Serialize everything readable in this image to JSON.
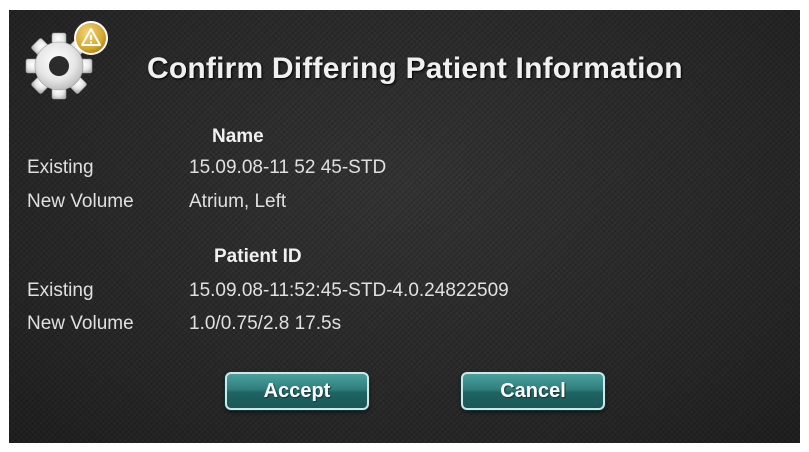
{
  "dialog": {
    "title": "Confirm Differing Patient Information",
    "header_icon": "gear-warning-icon"
  },
  "name_section": {
    "heading": "Name",
    "existing_label": "Existing",
    "existing_value": "15.09.08-11 52 45-STD",
    "new_label": "New Volume",
    "new_value": "Atrium, Left"
  },
  "patient_id_section": {
    "heading": "Patient ID",
    "existing_label": "Existing",
    "existing_value": "15.09.08-11:52:45-STD-4.0.24822509",
    "new_label": "New Volume",
    "new_value": "1.0/0.75/2.8 17.5s"
  },
  "buttons": {
    "accept_label": "Accept",
    "cancel_label": "Cancel"
  },
  "colors": {
    "background": "#2b2b2b",
    "button_teal": "#2f7f7d",
    "warning_yellow": "#d4a72c"
  }
}
